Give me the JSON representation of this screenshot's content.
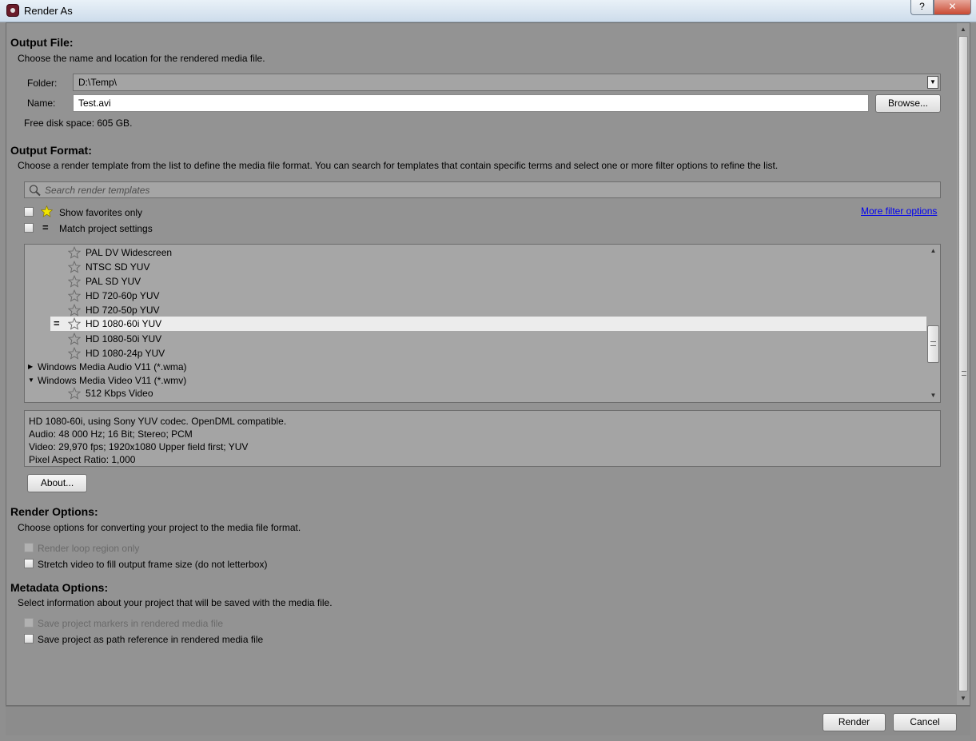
{
  "window": {
    "title": "Render As",
    "help_label": "?",
    "close_label": "✕"
  },
  "output_file": {
    "heading": "Output File:",
    "description": "Choose the name and location for the rendered media file.",
    "folder_label": "Folder:",
    "folder_value": "D:\\Temp\\",
    "name_label": "Name:",
    "name_value": "Test.avi",
    "browse_label": "Browse...",
    "free_space": "Free disk space: 605 GB."
  },
  "output_format": {
    "heading": "Output Format:",
    "description": "Choose a render template from the list to define the media file format. You can search for templates that contain specific terms and select one or more filter options to refine the list.",
    "search_placeholder": "Search render templates",
    "show_favorites_label": "Show favorites only",
    "match_project_label": "Match project settings",
    "more_filter_label": "More filter options",
    "templates": [
      {
        "label": "PAL DV Widescreen",
        "type": "item"
      },
      {
        "label": "NTSC SD YUV",
        "type": "item"
      },
      {
        "label": "PAL SD YUV",
        "type": "item"
      },
      {
        "label": "HD 720-60p YUV",
        "type": "item"
      },
      {
        "label": "HD 720-50p YUV",
        "type": "item"
      },
      {
        "label": "HD 1080-60i YUV",
        "type": "item",
        "selected": true
      },
      {
        "label": "HD 1080-50i YUV",
        "type": "item"
      },
      {
        "label": "HD 1080-24p YUV",
        "type": "item"
      },
      {
        "label": "Windows Media Audio V11 (*.wma)",
        "type": "group",
        "expanded": false
      },
      {
        "label": "Windows Media Video V11 (*.wmv)",
        "type": "group",
        "expanded": true
      },
      {
        "label": "512 Kbps Video",
        "type": "item"
      }
    ],
    "details": [
      "HD 1080-60i, using Sony YUV codec. OpenDML compatible.",
      "Audio: 48 000 Hz; 16 Bit; Stereo; PCM",
      "Video: 29,970 fps; 1920x1080 Upper field first; YUV",
      "Pixel Aspect Ratio: 1,000"
    ],
    "about_label": "About..."
  },
  "render_options": {
    "heading": "Render Options:",
    "description": "Choose options for converting your project to the media file format.",
    "loop_region_label": "Render loop region only",
    "stretch_label": "Stretch video to fill output frame size (do not letterbox)"
  },
  "metadata_options": {
    "heading": "Metadata Options:",
    "description": "Select information about your project that will be saved with the media file.",
    "markers_label": "Save project markers in rendered media file",
    "path_ref_label": "Save project as path reference in rendered media file"
  },
  "footer": {
    "render_label": "Render",
    "cancel_label": "Cancel"
  },
  "colors": {
    "panel_bg": "#939393",
    "selection_bg": "#ececec",
    "link": "#0000ee",
    "favorite_star": "#f2e600"
  }
}
